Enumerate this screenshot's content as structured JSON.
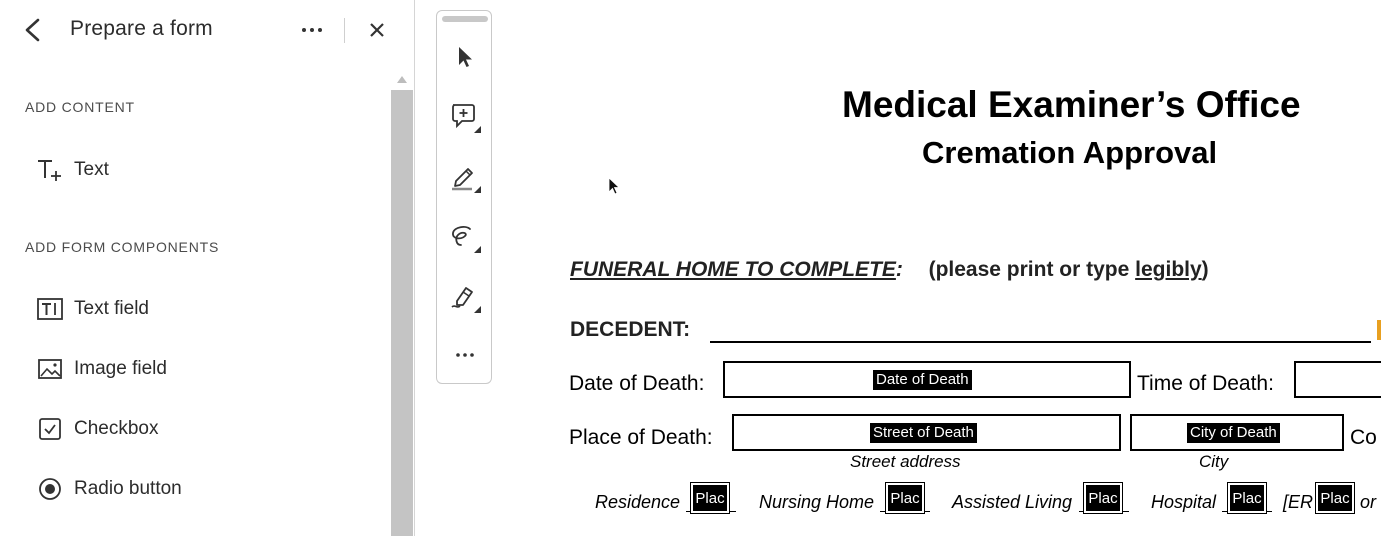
{
  "panel": {
    "title": "Prepare a form",
    "sections": {
      "add_content": "ADD CONTENT",
      "add_form_components": "ADD FORM COMPONENTS"
    },
    "items": {
      "text": "Text",
      "text_field": "Text field",
      "image_field": "Image field",
      "checkbox": "Checkbox",
      "radio_button": "Radio button"
    }
  },
  "toolbar": {
    "tools": [
      "select-pointer",
      "add-comment",
      "highlight",
      "draw-freeform",
      "fill-and-sign",
      "more"
    ]
  },
  "document": {
    "title": "Medical Examiner’s Office",
    "subtitle": "Cremation Approval",
    "funeral_home": "FUNERAL HOME TO COMPLETE",
    "funeral_colon": ":",
    "print_note_prefix": "(please print or type ",
    "print_note_word": "legibly",
    "print_note_suffix": ")",
    "decedent": "DECEDENT:",
    "date_of_death_label": "Date of Death:",
    "date_of_death_field": "Date of Death",
    "time_of_death_label": "Time of Death:",
    "place_of_death_label": "Place of Death:",
    "street_field": "Street of Death",
    "city_field": "City of Death",
    "county_partial": "Co",
    "street_sub": "Street address",
    "city_sub": "City",
    "options": [
      "Residence",
      "Nursing Home",
      "Assisted Living",
      "Hospital",
      "[ER",
      "or"
    ],
    "place_tag": "Plac"
  }
}
